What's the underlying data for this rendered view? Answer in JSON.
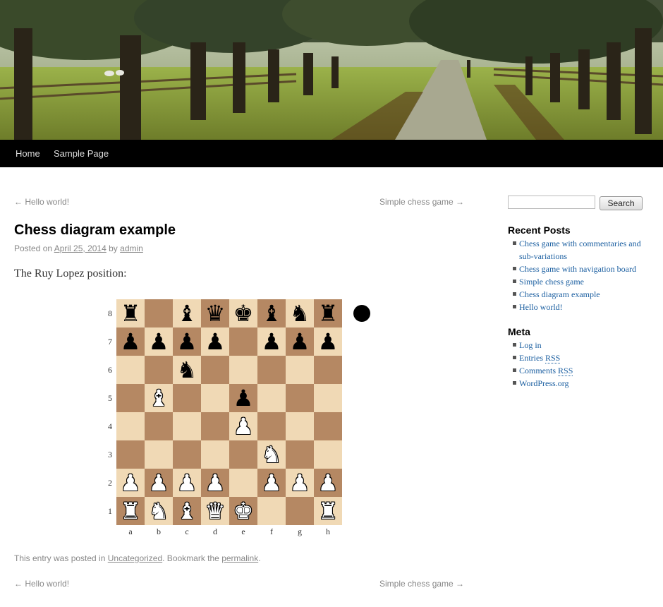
{
  "nav": {
    "items": [
      "Home",
      "Sample Page"
    ]
  },
  "post_nav": {
    "prev": "← Hello world!",
    "next": "Simple chess game →"
  },
  "post": {
    "title": "Chess diagram example",
    "meta_prefix": "Posted on",
    "date": "April 25, 2014",
    "meta_by": "by",
    "author": "admin",
    "intro": "The Ruy Lopez position:",
    "footer_prefix": "This entry was posted in",
    "category": "Uncategorized",
    "footer_mid": ". Bookmark the",
    "permalink": "permalink",
    "footer_end": "."
  },
  "chessboard": {
    "ranks": [
      "8",
      "7",
      "6",
      "5",
      "4",
      "3",
      "2",
      "1"
    ],
    "files": [
      "a",
      "b",
      "c",
      "d",
      "e",
      "f",
      "g",
      "h"
    ],
    "position": [
      [
        "r",
        "",
        "b",
        "q",
        "k",
        "b",
        "n",
        "r"
      ],
      [
        "p",
        "p",
        "p",
        "p",
        "",
        "p",
        "p",
        "p"
      ],
      [
        "",
        "",
        "n",
        "",
        "",
        "",
        "",
        ""
      ],
      [
        "",
        "B",
        "",
        "",
        "p",
        "",
        "",
        ""
      ],
      [
        "",
        "",
        "",
        "",
        "P",
        "",
        "",
        ""
      ],
      [
        "",
        "",
        "",
        "",
        "",
        "N",
        "",
        ""
      ],
      [
        "P",
        "P",
        "P",
        "P",
        "",
        "P",
        "P",
        "P"
      ],
      [
        "R",
        "N",
        "B",
        "Q",
        "K",
        "",
        "",
        "R"
      ]
    ],
    "side_to_move": "black",
    "colors": {
      "light": "#f0d9b5",
      "dark": "#b58863"
    }
  },
  "sidebar": {
    "search_button": "Search",
    "recent_title": "Recent Posts",
    "recent": [
      "Chess game with commentaries and sub-variations",
      "Chess game with navigation board",
      "Simple chess game",
      "Chess diagram example",
      "Hello world!"
    ],
    "meta_title": "Meta",
    "meta_links": {
      "login": "Log in",
      "entries_prefix": "Entries",
      "comments_prefix": "Comments",
      "rss": "RSS",
      "wordpress": "WordPress.org"
    }
  },
  "colors": {
    "link": "#1a5ea0",
    "nav_bg": "#000000"
  }
}
